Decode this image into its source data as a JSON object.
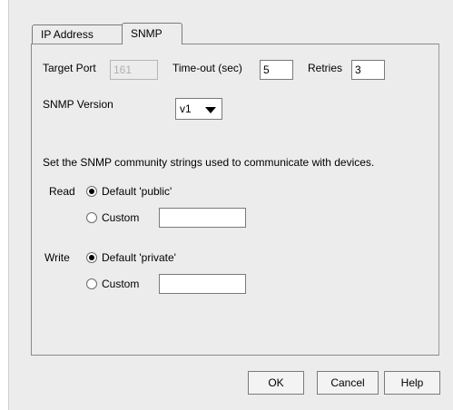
{
  "tabs": [
    {
      "label": "IP Address",
      "active": false
    },
    {
      "label": "SNMP",
      "active": true
    }
  ],
  "target_port": {
    "label": "Target Port",
    "value": "161",
    "disabled": true
  },
  "timeout": {
    "label": "Time-out (sec)",
    "value": "5"
  },
  "retries": {
    "label": "Retries",
    "value": "3"
  },
  "snmp_version": {
    "label": "SNMP Version",
    "selected": "v1"
  },
  "community_description": "Set the SNMP community strings used to communicate with devices.",
  "read": {
    "label": "Read",
    "default_option": "Default 'public'",
    "custom_option": "Custom",
    "selected": "default",
    "custom_value": ""
  },
  "write": {
    "label": "Write",
    "default_option": "Default 'private'",
    "custom_option": "Custom",
    "selected": "default",
    "custom_value": ""
  },
  "buttons": {
    "ok": "OK",
    "cancel": "Cancel",
    "help": "Help"
  }
}
